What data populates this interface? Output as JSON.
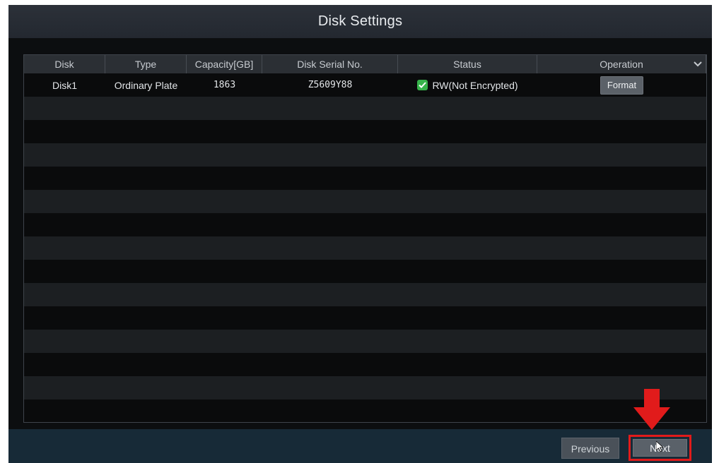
{
  "window": {
    "title": "Disk Settings"
  },
  "table": {
    "columns": [
      "Disk",
      "Type",
      "Capacity[GB]",
      "Disk Serial No.",
      "Status",
      "Operation"
    ],
    "rows": [
      {
        "disk": "Disk1",
        "type": "Ordinary Plate",
        "capacity": "1863",
        "serial": "Z5609Y88",
        "status": "RW(Not Encrypted)",
        "operation": "Format"
      }
    ]
  },
  "footer": {
    "previous_label": "Previous",
    "next_label": "Next"
  },
  "icons": {
    "status_icon": "check-icon",
    "header_toggle": "chevron-down-icon",
    "highlight": "red-arrow-icon"
  },
  "colors": {
    "title_bar": "#2c3139",
    "footer": "#172a37",
    "highlight": "#e11b1b",
    "status_ok": "#36b34a"
  }
}
